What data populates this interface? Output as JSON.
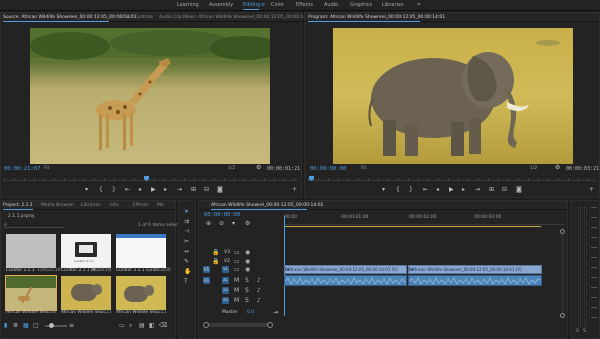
{
  "workspaces": {
    "items": [
      "Learning",
      "Assembly",
      "Editing",
      "Color",
      "Effects",
      "Audio",
      "Graphics",
      "Libraries"
    ],
    "active": "Editing",
    "more_label": "»"
  },
  "source": {
    "tab_source": "Source: African Wildlife Showreel_00:00:12:05_00:00:14:01",
    "tab_effect_controls": "Effect Controls",
    "tab_audio_mixer": "Audio Clip Mixer: African Wildlife Showreel_00:00:12:05_00:00:14:01",
    "timecode": "00:00:21:07",
    "fit": "Fit",
    "resolution": "1/2",
    "duration": "00:00:01:21"
  },
  "program": {
    "tab_program": "Program: African Wildlife Showreel_00:00:12:05_00:00:14:01",
    "timecode": "00:00:00:00",
    "fit": "Fit",
    "resolution": "1/2",
    "duration": "00:00:03:21"
  },
  "project": {
    "tabs": [
      "Project: 2.1.1",
      "Media Browser",
      "Libraries",
      "Info",
      "Effects",
      "Ma"
    ],
    "file_name": "2.1.1.prproj",
    "selection_status": "1 of 6 items selected",
    "items": [
      {
        "name": "Curator 2.1.1",
        "duration": "1;00;21;19"
      },
      {
        "name": "Curator 2.1.1 (fl...",
        "duration": "00;00;00"
      },
      {
        "name": "Curator 2.1.1 curato...",
        "duration": "0;00"
      },
      {
        "name": "African Wildlife Sho...",
        "duration": "0:04"
      },
      {
        "name": "African Wildlife Sho...",
        "duration": "3:21"
      },
      {
        "name": "African Wildlife Sho...",
        "duration": "3:11"
      }
    ],
    "thumb_caption": "Curator 2.1.1"
  },
  "timeline": {
    "tab": "African Wildlife Showrel_00:00:12:05_00:00:14:01",
    "timecode": "00:00:00:00",
    "ruler_labels": [
      "00:00",
      "00:00:01:00",
      "00:00:02:00",
      "00:00:03:00"
    ],
    "tracks": [
      "V3",
      "V2",
      "V1",
      "A1",
      "A2",
      "A3"
    ],
    "source_patch_v": "V1",
    "source_patch_a": "A1",
    "master_label": "Master",
    "master_value": "0.0",
    "clips": [
      {
        "label": "African Wildlife Showreel_00:00:12:05_00:00:14:01 [V]"
      },
      {
        "label": "African Wildlife Showreel_00:00:12:05_00:00:14:01 [V]"
      }
    ],
    "fx_label": "fx"
  },
  "colors": {
    "accent": "#4d9de0",
    "video_clip": "#8aa7cf",
    "audio_clip": "#4f84b9",
    "bg": "#1d1d1d"
  }
}
